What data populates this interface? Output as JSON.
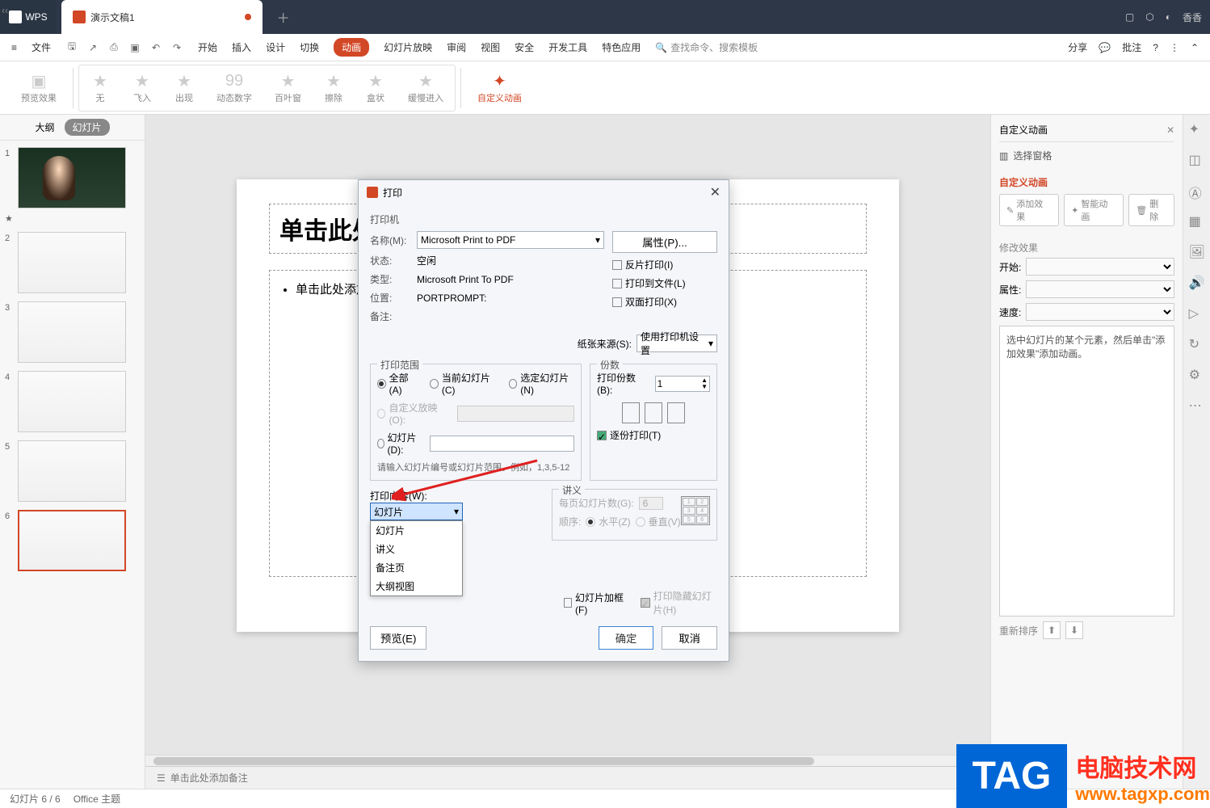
{
  "titlebar": {
    "wps": "WPS",
    "tab": "演示文稿1",
    "user": "香香"
  },
  "menubar": {
    "file": "文件",
    "items": [
      "开始",
      "插入",
      "设计",
      "切换",
      "动画",
      "幻灯片放映",
      "审阅",
      "视图",
      "安全",
      "开发工具",
      "特色应用"
    ],
    "active": "动画",
    "search": "查找命令、搜索模板",
    "share": "分享",
    "comment": "批注"
  },
  "ribbon": {
    "preview": "预览效果",
    "anims": [
      "无",
      "飞入",
      "出现",
      "动态数字",
      "百叶窗",
      "擦除",
      "盒状",
      "缓慢进入"
    ],
    "custom": "自定义动画"
  },
  "thumbs": {
    "outline": "大纲",
    "slides": "幻灯片",
    "items": [
      1,
      2,
      3,
      4,
      5,
      6
    ],
    "star": "★"
  },
  "slide": {
    "title_placeholder": "单击此处添加标题",
    "body_placeholder": "单击此处添加文本"
  },
  "notes": "单击此处添加备注",
  "rightpane": {
    "title": "自定义动画",
    "select_pane": "选择窗格",
    "section": "自定义动画",
    "add_effect": "添加效果",
    "smart_anim": "智能动画",
    "delete": "删除",
    "modify": "修改效果",
    "start": "开始:",
    "property": "属性:",
    "speed": "速度:",
    "hint": "选中幻灯片的某个元素，然后单击\"添加效果\"添加动画。",
    "reorder": "重新排序"
  },
  "statusbar": {
    "page": "幻灯片 6 / 6",
    "theme": "Office 主题"
  },
  "dialog": {
    "title": "打印",
    "printer_section": "打印机",
    "name_label": "名称(M):",
    "name_value": "Microsoft Print to PDF",
    "props_btn": "属性(P)...",
    "status_label": "状态:",
    "status_value": "空闲",
    "type_label": "类型:",
    "type_value": "Microsoft Print To PDF",
    "location_label": "位置:",
    "location_value": "PORTPROMPT:",
    "comment_label": "备注:",
    "chk_reverse": "反片打印(I)",
    "chk_tofile": "打印到文件(L)",
    "chk_duplex": "双面打印(X)",
    "paper_source_label": "纸张来源(S):",
    "paper_source_value": "使用打印机设置",
    "range_legend": "打印范围",
    "range_all": "全部(A)",
    "range_current": "当前幻灯片(C)",
    "range_selected": "选定幻灯片(N)",
    "range_custom": "自定义放映(O):",
    "range_slides": "幻灯片(D):",
    "range_hint": "请输入幻灯片编号或幻灯片范围。例如，1,3,5-12",
    "copies_legend": "份数",
    "copies_label": "打印份数(B):",
    "copies_value": "1",
    "collate": "逐份打印(T)",
    "content_label": "打印内容(W):",
    "content_value": "幻灯片",
    "content_options": [
      "幻灯片",
      "讲义",
      "备注页",
      "大纲视图"
    ],
    "handout_legend": "讲义",
    "handout_per_label": "每页幻灯片数(G):",
    "handout_per_value": "6",
    "handout_order_label": "顺序:",
    "handout_horiz": "水平(Z)",
    "handout_vert": "垂直(V)",
    "frame_chk": "幻灯片加框(F)",
    "hidden_chk": "打印隐藏幻灯片(H)",
    "preview_btn": "预览(E)",
    "ok_btn": "确定",
    "cancel_btn": "取消"
  },
  "watermark": {
    "tag": "TAG",
    "text": "电脑技术网",
    "url": "www.tagxp.com"
  }
}
